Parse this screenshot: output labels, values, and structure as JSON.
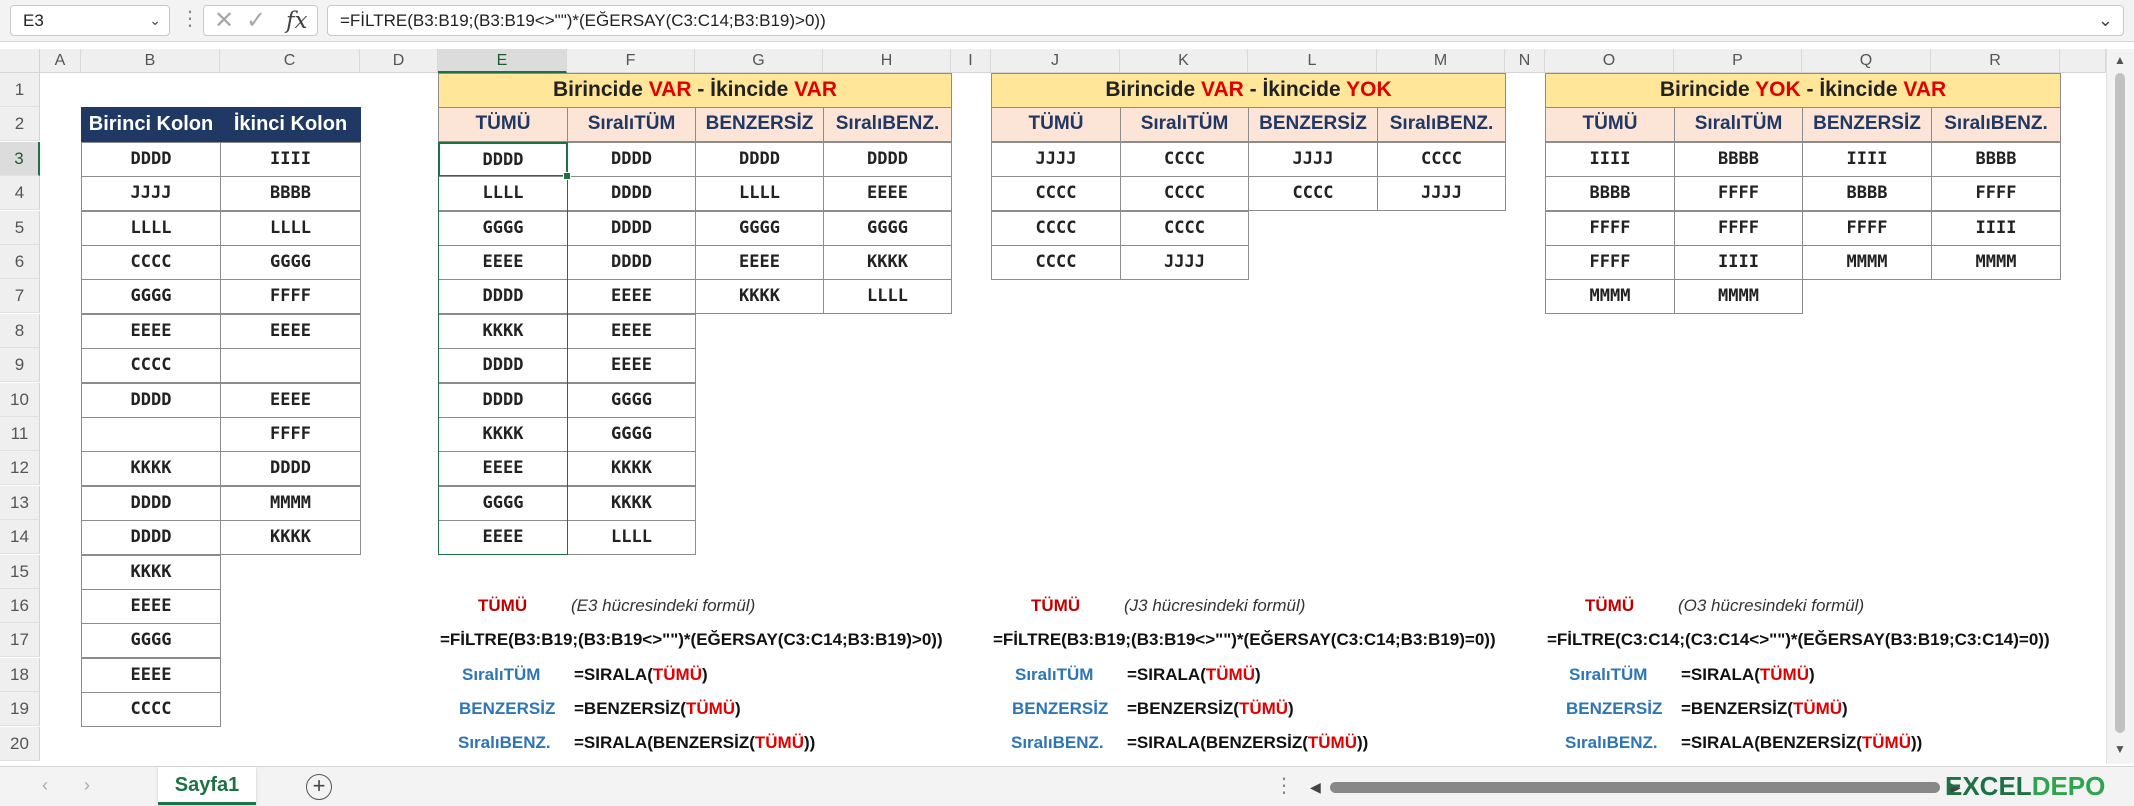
{
  "formula_bar": {
    "name_box": "E3",
    "formula": "=FİLTRE(B3:B19;(B3:B19<>\"\")*(EĞERSAY(C3:C14;B3:B19)>0))",
    "fx_label": "fx",
    "cancel_glyph": "✕",
    "enter_glyph": "✓"
  },
  "columns": [
    "A",
    "B",
    "C",
    "D",
    "E",
    "F",
    "G",
    "H",
    "I",
    "J",
    "K",
    "L",
    "M",
    "N",
    "O",
    "P",
    "Q",
    "R"
  ],
  "selected_cell": "E3",
  "rows": [
    "1",
    "2",
    "3",
    "4",
    "5",
    "6",
    "7",
    "8",
    "9",
    "10",
    "11",
    "12",
    "13",
    "14",
    "15",
    "16",
    "17",
    "18",
    "19",
    "20"
  ],
  "source_table": {
    "headers": [
      "Birinci Kolon",
      "İkinci Kolon"
    ],
    "col_b": [
      "DDDD",
      "JJJJ",
      "LLLL",
      "CCCC",
      "GGGG",
      "EEEE",
      "CCCC",
      "DDDD",
      "",
      "KKKK",
      "DDDD",
      "DDDD",
      "KKKK",
      "EEEE",
      "GGGG",
      "EEEE",
      "CCCC"
    ],
    "col_c": [
      "IIII",
      "BBBB",
      "LLLL",
      "GGGG",
      "FFFF",
      "EEEE",
      "",
      "EEEE",
      "FFFF",
      "DDDD",
      "MMMM",
      "KKKK"
    ]
  },
  "block1": {
    "title_pre": "Birincide ",
    "title_a": "VAR",
    "title_mid": " - İkincide ",
    "title_b": "VAR",
    "headers": [
      "TÜMÜ",
      "SıralıTÜM",
      "BENZERSİZ",
      "SıralıBENZ."
    ],
    "cols": [
      [
        "DDDD",
        "LLLL",
        "GGGG",
        "EEEE",
        "DDDD",
        "KKKK",
        "DDDD",
        "DDDD",
        "KKKK",
        "EEEE",
        "GGGG",
        "EEEE"
      ],
      [
        "DDDD",
        "DDDD",
        "DDDD",
        "DDDD",
        "EEEE",
        "EEEE",
        "EEEE",
        "GGGG",
        "GGGG",
        "KKKK",
        "KKKK",
        "LLLL"
      ],
      [
        "DDDD",
        "LLLL",
        "GGGG",
        "EEEE",
        "KKKK"
      ],
      [
        "DDDD",
        "EEEE",
        "GGGG",
        "KKKK",
        "LLLL"
      ]
    ],
    "note": {
      "name": "TÜMÜ",
      "cell_note": "(E3 hücresindeki formül)",
      "formula": "=FİLTRE(B3:B19;(B3:B19<>\"\")*(EĞERSAY(C3:C14;B3:B19)>0))",
      "sirali_label": "SıralıTÜM",
      "benzersiz_label": "BENZERSİZ",
      "siralibenz_label": "SıralıBENZ.",
      "f_sirala": "=SIRALA(",
      "f_benzersiz": "=BENZERSİZ(",
      "f_sirala_benz": "=SIRALA(BENZERSİZ(",
      "arg": "TÜMÜ",
      "close1": ")",
      "close2": "))"
    }
  },
  "block2": {
    "title_pre": "Birincide ",
    "title_a": "VAR",
    "title_mid": " - İkincide ",
    "title_b": "YOK",
    "headers": [
      "TÜMÜ",
      "SıralıTÜM",
      "BENZERSİZ",
      "SıralıBENZ."
    ],
    "cols": [
      [
        "JJJJ",
        "CCCC",
        "CCCC",
        "CCCC"
      ],
      [
        "CCCC",
        "CCCC",
        "CCCC",
        "JJJJ"
      ],
      [
        "JJJJ",
        "CCCC"
      ],
      [
        "CCCC",
        "JJJJ"
      ]
    ],
    "note": {
      "name": "TÜMÜ",
      "cell_note": "(J3 hücresindeki formül)",
      "formula": "=FİLTRE(B3:B19;(B3:B19<>\"\")*(EĞERSAY(C3:C14;B3:B19)=0))"
    }
  },
  "block3": {
    "title_pre": "Birincide ",
    "title_a": "YOK",
    "title_mid": " - İkincide ",
    "title_b": "VAR",
    "headers": [
      "TÜMÜ",
      "SıralıTÜM",
      "BENZERSİZ",
      "SıralıBENZ."
    ],
    "cols": [
      [
        "IIII",
        "BBBB",
        "FFFF",
        "FFFF",
        "MMMM"
      ],
      [
        "BBBB",
        "FFFF",
        "FFFF",
        "IIII",
        "MMMM"
      ],
      [
        "IIII",
        "BBBB",
        "FFFF",
        "MMMM"
      ],
      [
        "BBBB",
        "FFFF",
        "IIII",
        "MMMM"
      ]
    ],
    "note": {
      "name": "TÜMÜ",
      "cell_note": "(O3 hücresindeki formül)",
      "formula": "=FİLTRE(C3:C14;(C3:C14<>\"\")*(EĞERSAY(B3:B19;C3:C14)=0))"
    }
  },
  "sheet_tab": "Sayfa1",
  "watermark": {
    "a": "EXCEL",
    "b": "DEPO"
  },
  "colors": {
    "excel_green": "#1e7145",
    "header_blue": "#203864",
    "title_yellow": "#ffe699",
    "sub_peach": "#fce4d6",
    "accent_red": "#e00000"
  }
}
